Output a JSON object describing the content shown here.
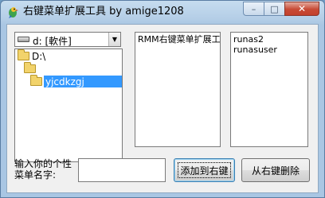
{
  "window": {
    "title": "右键菜单扩展工具 by amige1208",
    "minimize_glyph": "–",
    "maximize_glyph": "□",
    "close_glyph": "✕",
    "app_icon": "parrot-icon"
  },
  "drive_combo": {
    "value": "d: [軟件]",
    "icon": "drive-icon"
  },
  "folders": [
    {
      "label": "D:\\",
      "selected": false
    },
    {
      "label": "",
      "selected": false
    },
    {
      "label": "yjcdkzgj",
      "selected": true
    }
  ],
  "menu_list": {
    "items": [
      "RMM右键菜单扩展工"
    ]
  },
  "user_list": {
    "items": [
      "runas2",
      "runasuser"
    ]
  },
  "prompt_text": "输入你的个性菜单名字:",
  "name_input": {
    "value": ""
  },
  "buttons": {
    "add": "添加到右键",
    "remove": "从右键删除"
  },
  "colors": {
    "selection": "#3399ff",
    "title_bar": "#b3cde6",
    "close_button": "#c84a35"
  }
}
